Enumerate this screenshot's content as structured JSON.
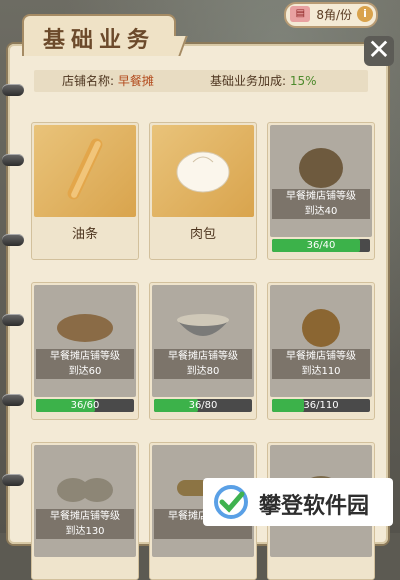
{
  "header": {
    "title": "基础业务",
    "currency": "8角/份",
    "close_symbol": "✕"
  },
  "info": {
    "shop_label": "店铺名称:",
    "shop_name": "早餐摊",
    "bonus_label": "基础业务加成:",
    "bonus_value": "15%"
  },
  "items": [
    {
      "name": "油条",
      "state": "unlocked",
      "icon": "youtiao-icon"
    },
    {
      "name": "肉包",
      "state": "unlocked",
      "icon": "baozi-icon"
    },
    {
      "requirement_line1": "早餐摊店铺等级",
      "requirement_line2": "到达40",
      "progress_text": "36/40",
      "progress": 0.9,
      "state": "locked",
      "icon": "bun-icon"
    },
    {
      "requirement_line1": "早餐摊店铺等级",
      "requirement_line2": "到达60",
      "progress_text": "36/60",
      "progress": 0.6,
      "state": "locked",
      "icon": "bread-icon"
    },
    {
      "requirement_line1": "早餐摊店铺等级",
      "requirement_line2": "到达80",
      "progress_text": "36/80",
      "progress": 0.45,
      "state": "locked",
      "icon": "soymilk-bowl-icon"
    },
    {
      "requirement_line1": "早餐摊店铺等级",
      "requirement_line2": "到达110",
      "progress_text": "36/110",
      "progress": 0.33,
      "state": "locked",
      "icon": "sesame-ball-icon"
    },
    {
      "requirement_line1": "早餐摊店铺等级",
      "requirement_line2": "到达130",
      "state": "locked",
      "icon": "dumplings-icon"
    },
    {
      "requirement_line1": "早餐摊店铺等级",
      "requirement_line2": "",
      "state": "locked",
      "icon": "spring-roll-icon"
    },
    {
      "requirement_line1": "",
      "requirement_line2": "",
      "state": "locked",
      "icon": "food-icon"
    }
  ],
  "watermark": "攀登软件园",
  "colors": {
    "progress": "#3cb24a",
    "accent": "#b24a1c"
  }
}
